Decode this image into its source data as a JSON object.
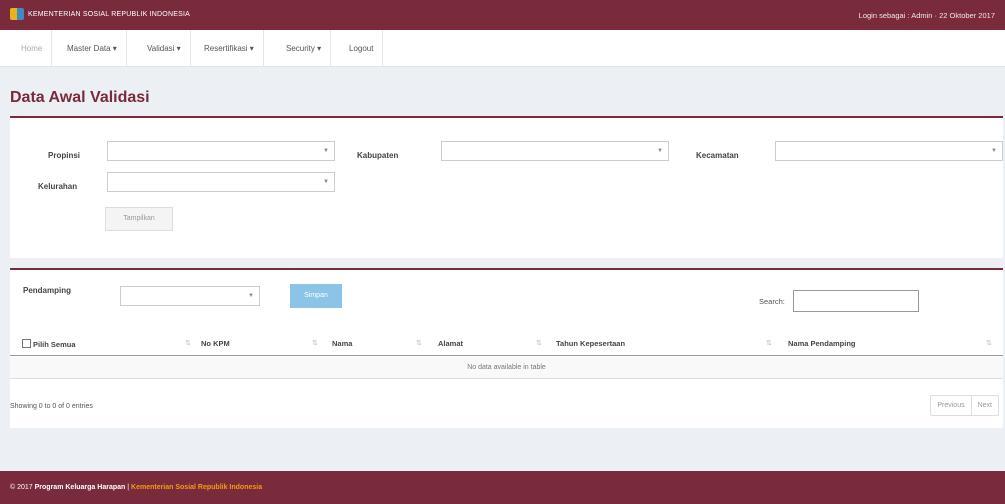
{
  "header": {
    "brand": "KEMENTERIAN SOSIAL REPUBLIK INDONESIA",
    "login_info": "Login sebagai : Admin · 22 Oktober 2017"
  },
  "nav": {
    "home": "Home",
    "items": [
      "Master Data ▾",
      "Validasi ▾",
      "Resertifikasi ▾",
      "Security ▾",
      "Logout"
    ]
  },
  "page": {
    "title": "Data Awal Validasi"
  },
  "filters": {
    "propinsi": "Propinsi",
    "kabupaten": "Kabupaten",
    "kecamatan": "Kecamatan",
    "kelurahan": "Kelurahan",
    "tampilkan": "Tampilkan"
  },
  "table_controls": {
    "pendamping": "Pendamping",
    "simpan": "Simpan",
    "search_label": "Search:"
  },
  "table": {
    "columns": [
      "Pilih Semua",
      "No KPM",
      "Nama",
      "Alamat",
      "Tahun Kepesertaan",
      "Nama Pendamping"
    ],
    "empty_message": "No data available in table",
    "info": "Showing 0 to 0 of 0 entries",
    "previous": "Previous",
    "next": "Next"
  },
  "footer": {
    "copyright": "© 2017",
    "program": "Program Keluarga Harapan",
    "separator": " | ",
    "ministry": "Kementerian Sosial Republik Indonesia"
  },
  "colors": {
    "brand": "#7a2b3b",
    "button_primary": "#8cc4e8",
    "footer_link": "#f39c12",
    "background": "#ecf0f5"
  }
}
